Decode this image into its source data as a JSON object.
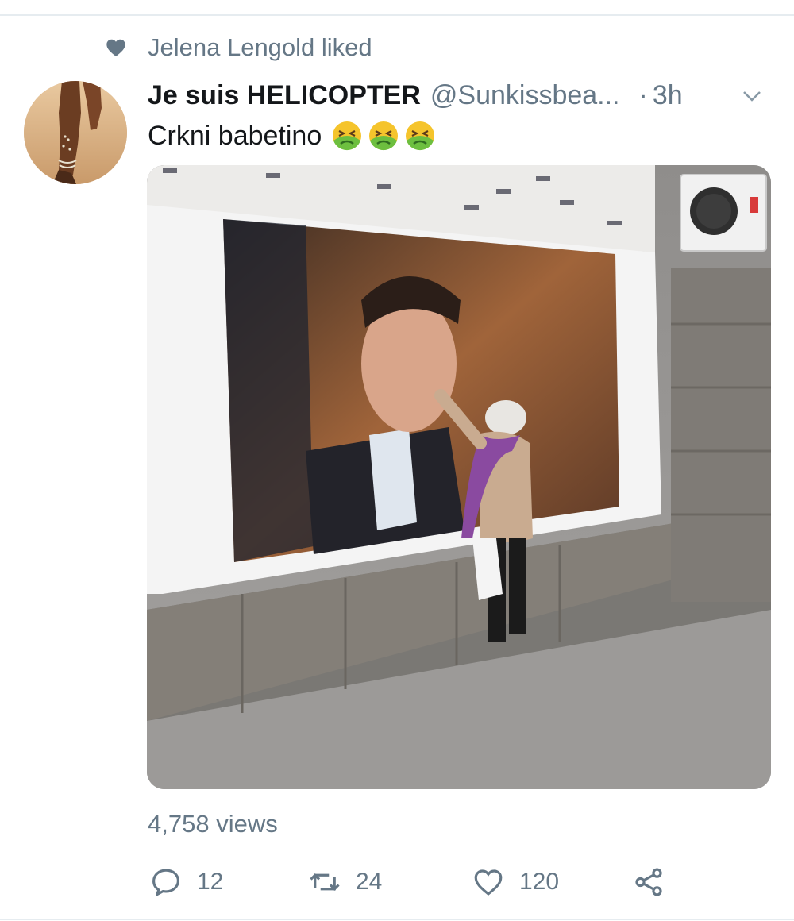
{
  "social_context": {
    "icon": "heart-icon",
    "text": "Jelena Lengold liked"
  },
  "tweet": {
    "author_name": "Je suis HELICOPTER",
    "handle": "@Sunkissbea...",
    "separator": "·",
    "time": "3h",
    "text": "Crkni babetino",
    "emojis": [
      "nauseated-face-emoji",
      "nauseated-face-emoji",
      "nauseated-face-emoji"
    ],
    "views": "4,758 views"
  },
  "actions": {
    "reply": {
      "icon": "reply-icon",
      "count": "12"
    },
    "retweet": {
      "icon": "retweet-icon",
      "count": "24"
    },
    "like": {
      "icon": "heart-outline-icon",
      "count": "120"
    },
    "share": {
      "icon": "share-icon"
    }
  },
  "colors": {
    "secondary_text": "#657786",
    "primary_text": "#14171a",
    "divider": "#e6ecf0",
    "emoji_face": "#f5c42c",
    "emoji_green": "#6dbf3f"
  }
}
